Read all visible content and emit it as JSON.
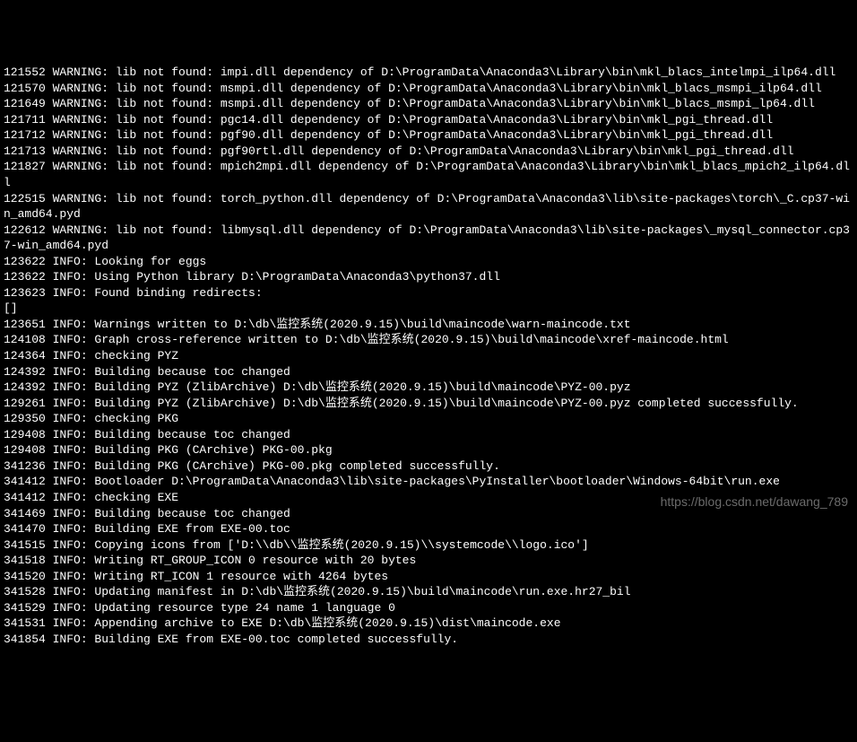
{
  "lines": [
    "121552 WARNING: lib not found: impi.dll dependency of D:\\ProgramData\\Anaconda3\\Library\\bin\\mkl_blacs_intelmpi_ilp64.dll",
    "121570 WARNING: lib not found: msmpi.dll dependency of D:\\ProgramData\\Anaconda3\\Library\\bin\\mkl_blacs_msmpi_ilp64.dll",
    "121649 WARNING: lib not found: msmpi.dll dependency of D:\\ProgramData\\Anaconda3\\Library\\bin\\mkl_blacs_msmpi_lp64.dll",
    "121711 WARNING: lib not found: pgc14.dll dependency of D:\\ProgramData\\Anaconda3\\Library\\bin\\mkl_pgi_thread.dll",
    "121712 WARNING: lib not found: pgf90.dll dependency of D:\\ProgramData\\Anaconda3\\Library\\bin\\mkl_pgi_thread.dll",
    "121713 WARNING: lib not found: pgf90rtl.dll dependency of D:\\ProgramData\\Anaconda3\\Library\\bin\\mkl_pgi_thread.dll",
    "121827 WARNING: lib not found: mpich2mpi.dll dependency of D:\\ProgramData\\Anaconda3\\Library\\bin\\mkl_blacs_mpich2_ilp64.dll",
    "122515 WARNING: lib not found: torch_python.dll dependency of D:\\ProgramData\\Anaconda3\\lib\\site-packages\\torch\\_C.cp37-win_amd64.pyd",
    "122612 WARNING: lib not found: libmysql.dll dependency of D:\\ProgramData\\Anaconda3\\lib\\site-packages\\_mysql_connector.cp37-win_amd64.pyd",
    "123622 INFO: Looking for eggs",
    "123622 INFO: Using Python library D:\\ProgramData\\Anaconda3\\python37.dll",
    "123623 INFO: Found binding redirects:",
    "[]",
    "123651 INFO: Warnings written to D:\\db\\监控系统(2020.9.15)\\build\\maincode\\warn-maincode.txt",
    "124108 INFO: Graph cross-reference written to D:\\db\\监控系统(2020.9.15)\\build\\maincode\\xref-maincode.html",
    "124364 INFO: checking PYZ",
    "124392 INFO: Building because toc changed",
    "124392 INFO: Building PYZ (ZlibArchive) D:\\db\\监控系统(2020.9.15)\\build\\maincode\\PYZ-00.pyz",
    "129261 INFO: Building PYZ (ZlibArchive) D:\\db\\监控系统(2020.9.15)\\build\\maincode\\PYZ-00.pyz completed successfully.",
    "129350 INFO: checking PKG",
    "129408 INFO: Building because toc changed",
    "129408 INFO: Building PKG (CArchive) PKG-00.pkg",
    "341236 INFO: Building PKG (CArchive) PKG-00.pkg completed successfully.",
    "341412 INFO: Bootloader D:\\ProgramData\\Anaconda3\\lib\\site-packages\\PyInstaller\\bootloader\\Windows-64bit\\run.exe",
    "341412 INFO: checking EXE",
    "341469 INFO: Building because toc changed",
    "341470 INFO: Building EXE from EXE-00.toc",
    "341515 INFO: Copying icons from ['D:\\\\db\\\\监控系统(2020.9.15)\\\\systemcode\\\\logo.ico']",
    "341518 INFO: Writing RT_GROUP_ICON 0 resource with 20 bytes",
    "341520 INFO: Writing RT_ICON 1 resource with 4264 bytes",
    "341528 INFO: Updating manifest in D:\\db\\监控系统(2020.9.15)\\build\\maincode\\run.exe.hr27_bil",
    "341529 INFO: Updating resource type 24 name 1 language 0",
    "341531 INFO: Appending archive to EXE D:\\db\\监控系统(2020.9.15)\\dist\\maincode.exe",
    "341854 INFO: Building EXE from EXE-00.toc completed successfully."
  ],
  "watermark": "https://blog.csdn.net/dawang_789"
}
